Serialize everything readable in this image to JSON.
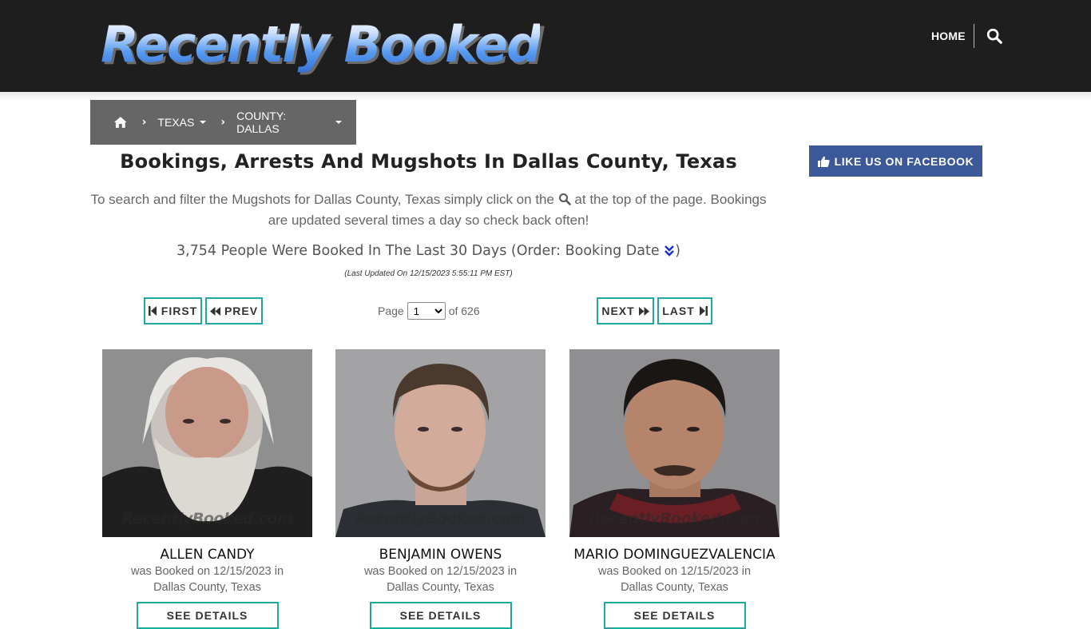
{
  "site": {
    "logo_text": "Recently Booked",
    "nav_home": "HOME"
  },
  "breadcrumb": {
    "state": "TEXAS",
    "county": "COUNTY: DALLAS"
  },
  "facebook": {
    "label": "LIKE US ON FACEBOOK",
    "color": "#3b5998"
  },
  "main": {
    "title": "Bookings, Arrests And Mugshots In Dallas County, Texas",
    "intro_before": "To search and filter the Mugshots for Dallas County, Texas simply click on the",
    "intro_after": "at the top of the page. Bookings are updated several times a day so check back often!",
    "count_text": "3,754 People Were Booked In The Last 30 Days (Order: Booking Date",
    "count_close": ")",
    "updated": "(Last Updated On 12/15/2023 5:55:11 PM EST)"
  },
  "pagination": {
    "first": "FIRST",
    "prev": "PREV",
    "next": "NEXT",
    "last": "LAST",
    "page_label": "Page",
    "current_page": "1",
    "of_label": "of 626",
    "accent_color": "#1fa8a0"
  },
  "watermark": "RecentlyBooked.com",
  "bookings": [
    {
      "name": "ALLEN CANDY",
      "booked_line": "was Booked on 12/15/2023 in",
      "location": "Dallas County, Texas",
      "button": "SEE DETAILS"
    },
    {
      "name": "BENJAMIN OWENS",
      "booked_line": "was Booked on 12/15/2023 in",
      "location": "Dallas County, Texas",
      "button": "SEE DETAILS"
    },
    {
      "name": "MARIO DOMINGUEZVALENCIA",
      "booked_line": "was Booked on 12/15/2023 in",
      "location": "Dallas County, Texas",
      "button": "SEE DETAILS"
    }
  ]
}
